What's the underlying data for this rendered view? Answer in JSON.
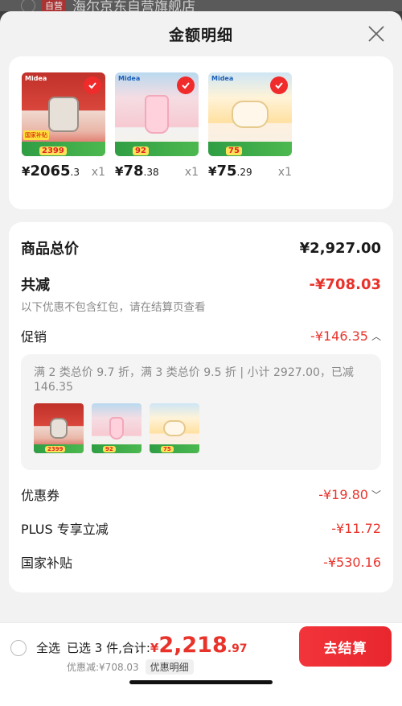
{
  "background": {
    "tag": "自营",
    "store_name": "海尔京东自营旗舰店"
  },
  "sheet": {
    "title": "金额明细"
  },
  "products": [
    {
      "price_currency": "¥",
      "price_int": "2065",
      "price_dec": ".3",
      "qty": "x1",
      "brand": "Midea",
      "deal": "2399"
    },
    {
      "price_currency": "¥",
      "price_int": "78",
      "price_dec": ".38",
      "qty": "x1",
      "brand": "Midea",
      "deal": "92"
    },
    {
      "price_currency": "¥",
      "price_int": "75",
      "price_dec": ".29",
      "qty": "x1",
      "brand": "Midea",
      "deal": "75"
    }
  ],
  "summary": {
    "total_label": "商品总价",
    "total_value": "¥2,927.00",
    "reduce_label": "共减",
    "reduce_value": "-¥708.03",
    "note": "以下优惠不包含红包，请在结算页查看",
    "promo_label": "促销",
    "promo_value": "-¥146.35",
    "promo_detail": "满 2 类总价 9.7 折，满 3 类总价 9.5 折 | 小计 2927.00，已减 146.35",
    "coupon_label": "优惠券",
    "coupon_value": "-¥19.80",
    "plus_label": "PLUS 专享立减",
    "plus_value": "-¥11.72",
    "subsidy_label": "国家补贴",
    "subsidy_value": "-¥530.16"
  },
  "footer": {
    "select_all_label": "全选",
    "selected_text": "已选 3 件,合计:",
    "sum_currency": "¥",
    "sum_int": "2,218",
    "sum_dec": ".97",
    "discount_text": "优惠减:¥708.03",
    "detail_chip": "优惠明细",
    "checkout_label": "去结算"
  },
  "colors": {
    "accent_red": "#e8332b",
    "checkout_red": "#f2353a"
  }
}
